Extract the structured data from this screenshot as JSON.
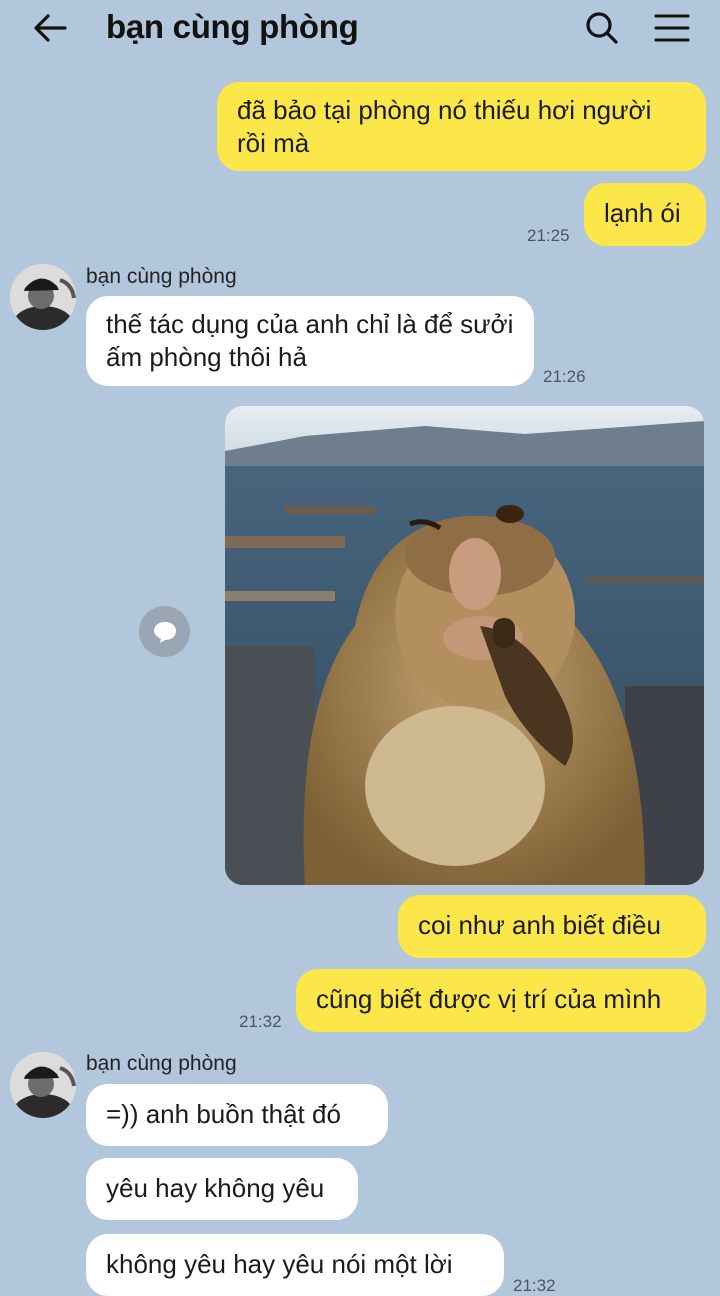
{
  "header": {
    "title": "bạn cùng phòng",
    "back_icon": "arrow-left-icon",
    "search_icon": "search-icon",
    "menu_icon": "menu-icon"
  },
  "colors": {
    "background": "#b2c7db",
    "outgoing_bubble": "#fbe74a",
    "incoming_bubble": "#ffffff"
  },
  "messages": {
    "m1": "đã bảo tại phòng nó thiếu hơi người rồi mà",
    "m2": "lạnh ói",
    "m2_time": "21:25",
    "g1_sender": "bạn cùng phòng",
    "m3": "thế tác dụng của anh chỉ là để sưởi ấm phòng thôi hả",
    "m3_time": "21:26",
    "image_alt": "monkey winking meme",
    "m4": "coi như anh biết điều",
    "m5": "cũng biết được vị trí của mình",
    "m5_time": "21:32",
    "g2_sender": "bạn cùng phòng",
    "m6": "=)) anh buồn thật đó",
    "m7": "yêu hay không yêu",
    "m8": "không yêu hay yêu nói một lời",
    "m8_time": "21:32"
  }
}
